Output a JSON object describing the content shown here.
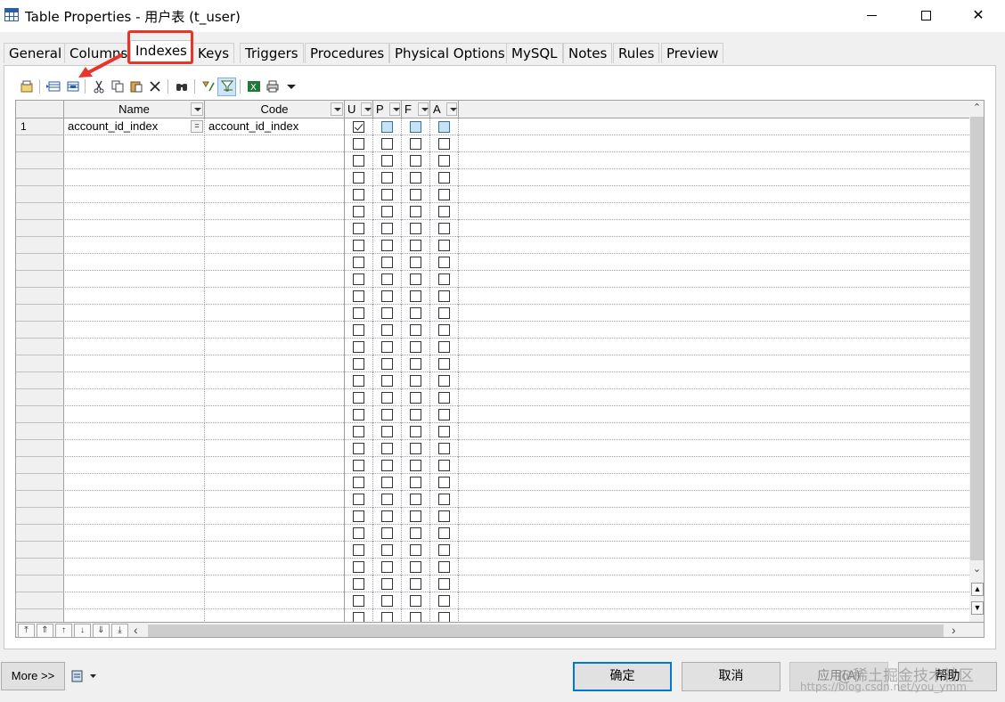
{
  "window": {
    "title": "Table Properties - 用户表 (t_user)",
    "minimize": "",
    "maximize": "",
    "close": "✕"
  },
  "tabs": [
    {
      "label": "General"
    },
    {
      "label": "Columns"
    },
    {
      "label": "Indexes",
      "active": true
    },
    {
      "label": "Keys"
    },
    {
      "label": "Triggers"
    },
    {
      "label": "Procedures"
    },
    {
      "label": "Physical Options"
    },
    {
      "label": "MySQL"
    },
    {
      "label": "Notes"
    },
    {
      "label": "Rules"
    },
    {
      "label": "Preview"
    }
  ],
  "toolbar_icons": [
    "properties-icon",
    "add-row-icon",
    "insert-row-icon",
    "cut-icon",
    "copy-icon",
    "paste-icon",
    "delete-icon",
    "find-icon",
    "customize-columns-icon",
    "filter-icon",
    "excel-export-icon",
    "print-icon",
    "dropdown-icon"
  ],
  "grid": {
    "columns": {
      "name": "Name",
      "code": "Code",
      "u": "U",
      "p": "P",
      "f": "F",
      "a": "A"
    },
    "rows": [
      {
        "num": "1",
        "name": "account_id_index",
        "code": "account_id_index",
        "u": true,
        "p": false,
        "f": false,
        "a": false
      }
    ],
    "empty_rows": 29
  },
  "footer": {
    "more": "More >>",
    "ok": "确定",
    "cancel": "取消",
    "apply": "应用(A)",
    "help": "帮助"
  },
  "watermark": {
    "line1": "@稀土掘金技术社区",
    "line2": "https://blog.csdn.net/you_ymm"
  },
  "colors": {
    "highlight": "#e8352b",
    "accent": "#0078d7"
  }
}
